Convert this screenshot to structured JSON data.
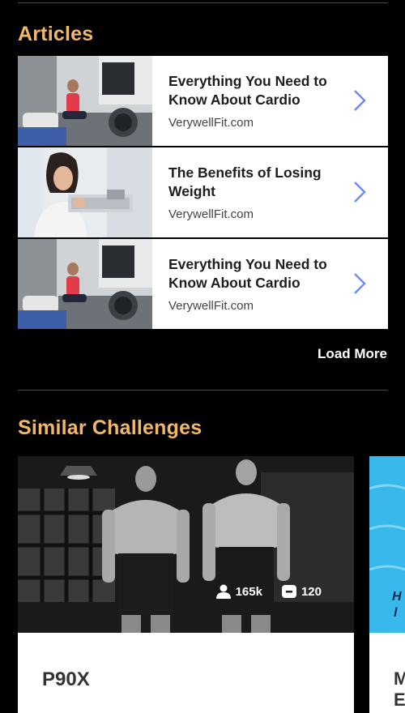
{
  "articles_section": {
    "title": "Articles",
    "items": [
      {
        "title": "Everything You Need to Know About Cardio",
        "source": "VerywellFit.com",
        "image": "rowing-machine-photo"
      },
      {
        "title": "The Benefits of Losing Weight",
        "source": "VerywellFit.com",
        "image": "woman-scale-photo"
      },
      {
        "title": "Everything You Need to Know About Cardio",
        "source": "VerywellFit.com",
        "image": "rowing-machine-photo"
      }
    ],
    "load_more_label": "Load More"
  },
  "similar_section": {
    "title": "Similar Challenges",
    "cards": [
      {
        "name": "P90X",
        "participants": "165k",
        "count": "120",
        "image": "bodybuilders-bw-photo"
      },
      {
        "name": "M\nE",
        "image": "water-illustration"
      }
    ]
  },
  "colors": {
    "accent": "#f2b866",
    "chevron": "#6b8ef0",
    "background": "#000000"
  }
}
